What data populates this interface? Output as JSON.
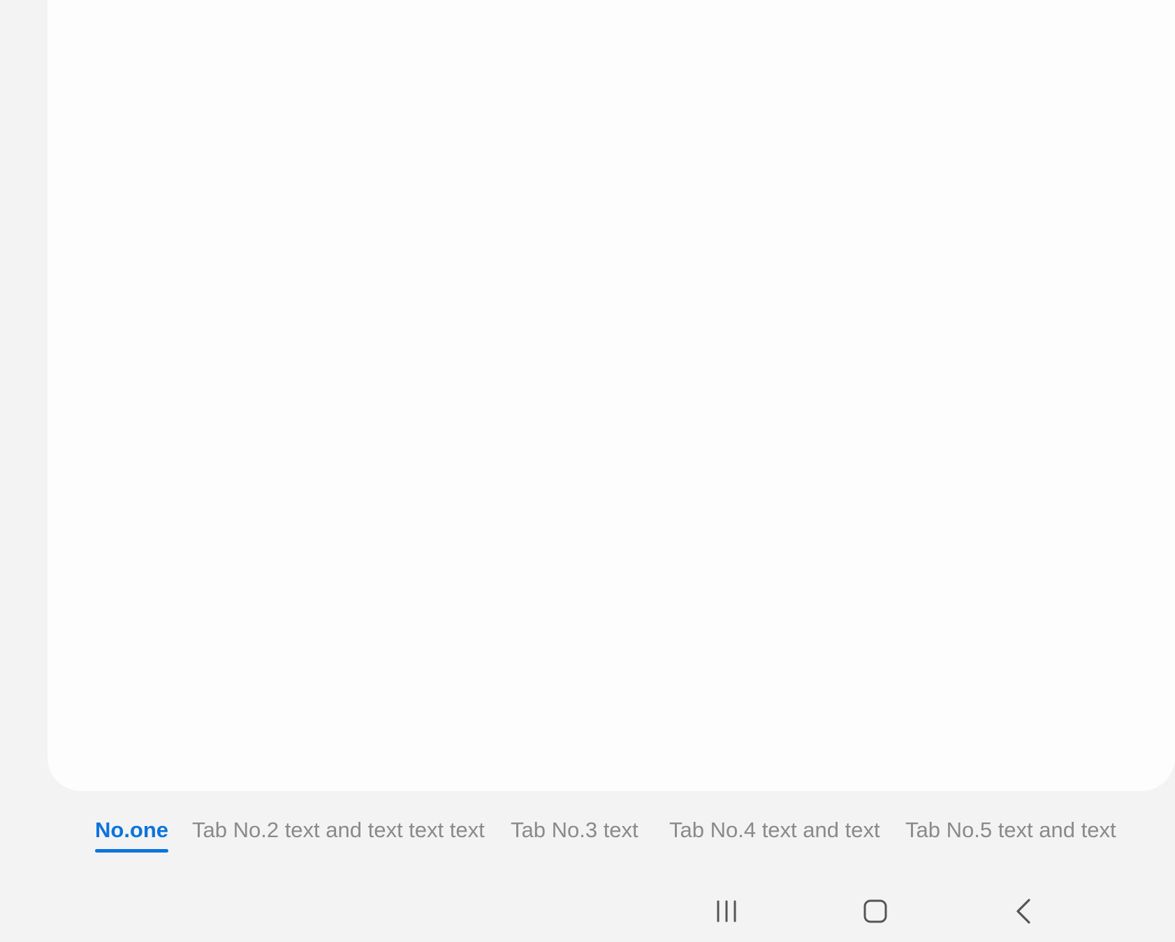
{
  "tabs": [
    {
      "label": "No.one",
      "active": true
    },
    {
      "label": "Tab No.2 text and text text text",
      "active": false
    },
    {
      "label": "Tab No.3 text",
      "active": false
    },
    {
      "label": "Tab No.4 text and text",
      "active": false
    },
    {
      "label": "Tab No.5 text and text",
      "active": false
    }
  ],
  "navigation_bar": {
    "buttons": [
      {
        "name": "recents",
        "icon": "recents-icon"
      },
      {
        "name": "home",
        "icon": "home-icon"
      },
      {
        "name": "back",
        "icon": "back-icon"
      }
    ]
  },
  "colors": {
    "accent": "#0b74de",
    "inactive_tab_text": "#8a8a8a",
    "background": "#f3f3f3",
    "card": "#fdfdfd",
    "nav_icon": "#555555"
  }
}
